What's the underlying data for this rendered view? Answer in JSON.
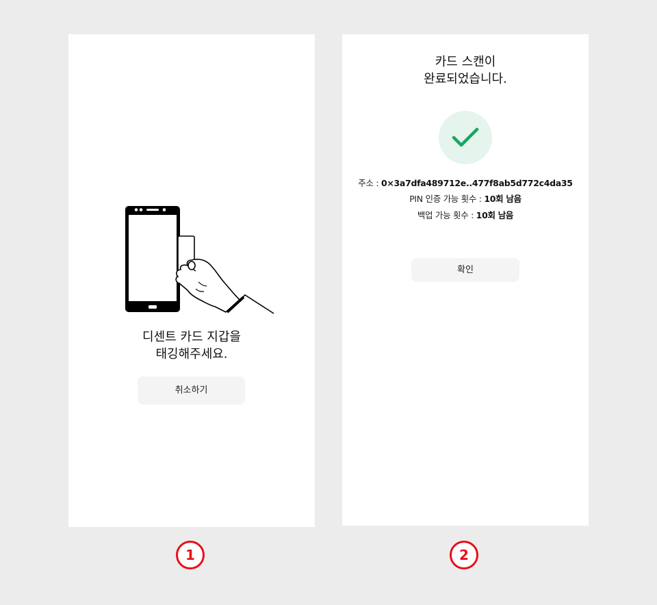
{
  "screen1": {
    "prompt_line1": "디센트 카드 지갑을",
    "prompt_line2": "태깅해주세요.",
    "cancel_label": "취소하기",
    "illustration_icon": "phone-card-tap-icon"
  },
  "screen2": {
    "title_line1": "카드 스캔이",
    "title_line2": "완료되었습니다.",
    "success_icon": "check-icon",
    "address_label": "주소 : ",
    "address_value": "0×3a7dfa489712e..477f8ab5d772c4da35",
    "pin_label": "PIN 인증 가능 횟수 : ",
    "pin_value": "10회 남음",
    "backup_label": "백업 가능 횟수 : ",
    "backup_value": "10회 남음",
    "confirm_label": "확인"
  },
  "steps": [
    "1",
    "2"
  ],
  "colors": {
    "background": "#ececec",
    "panel": "#ffffff",
    "button": "#f4f4f4",
    "success_green": "#1aa561",
    "success_bg": "#e5f4ec",
    "step_red": "#e8101a"
  }
}
